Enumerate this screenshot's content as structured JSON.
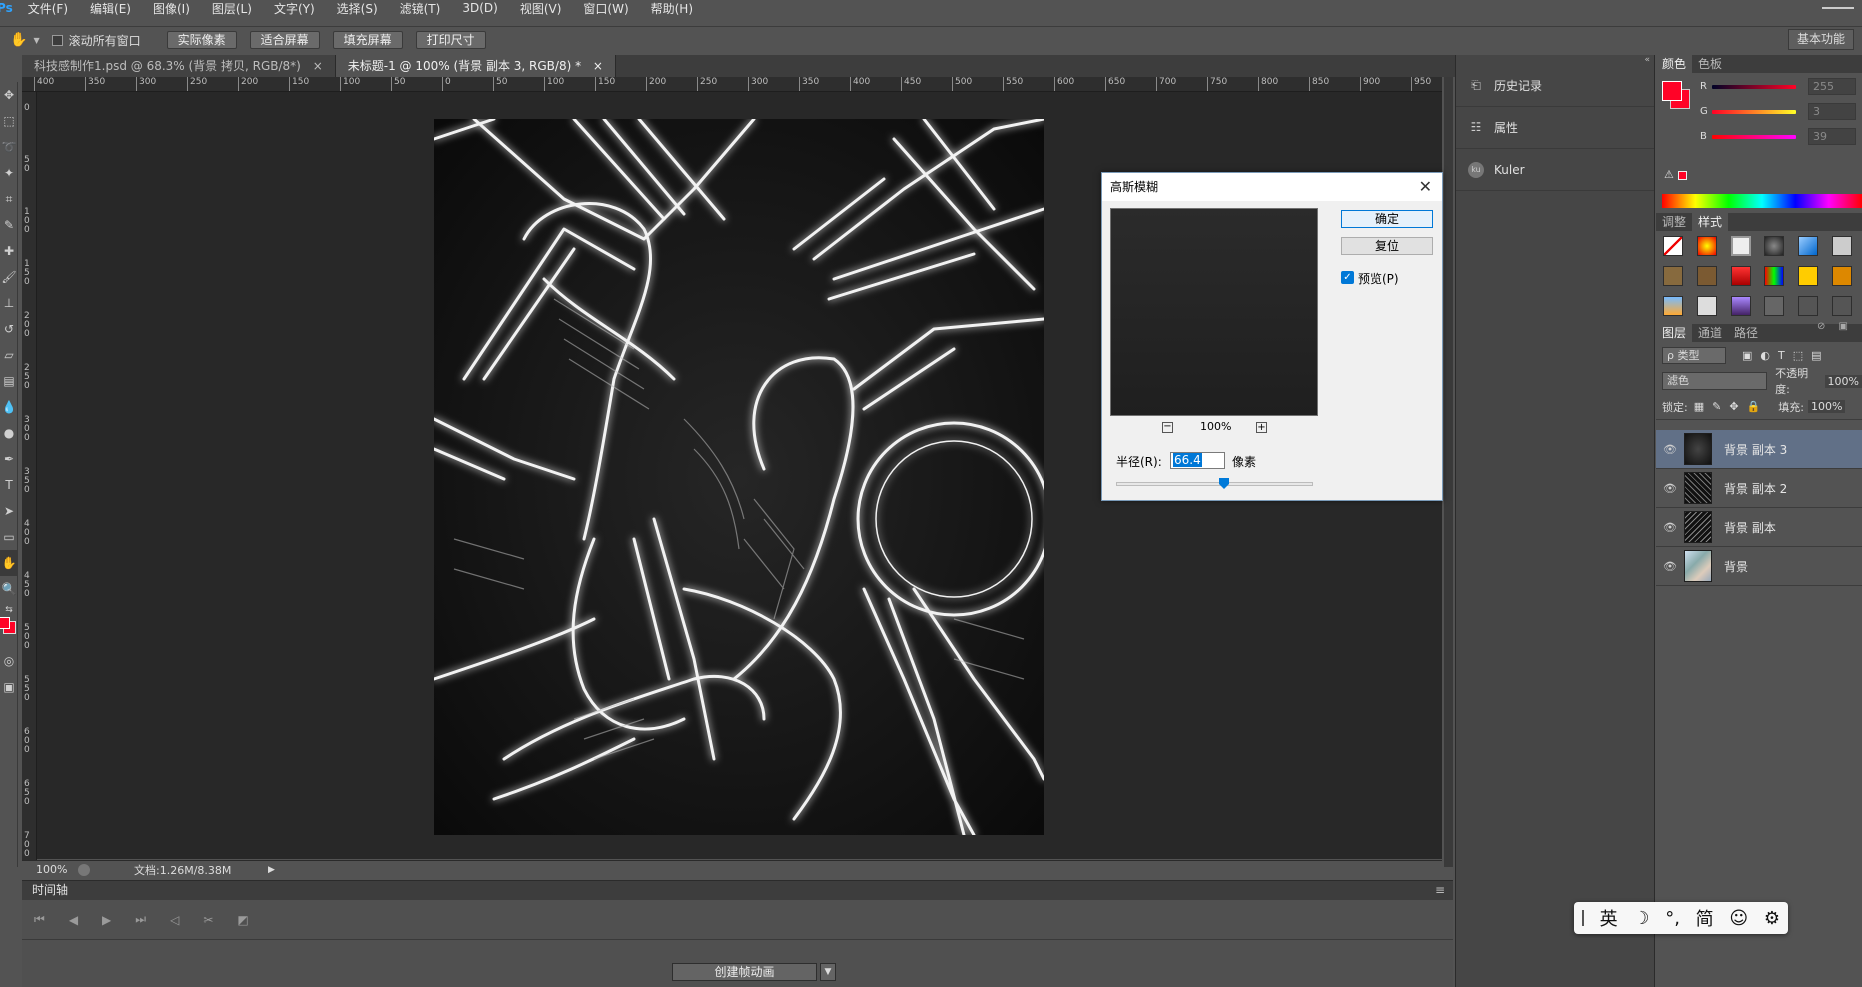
{
  "app": {
    "logo": "Ps"
  },
  "menu": [
    "文件(F)",
    "编辑(E)",
    "图像(I)",
    "图层(L)",
    "文字(Y)",
    "选择(S)",
    "滤镜(T)",
    "3D(D)",
    "视图(V)",
    "窗口(W)",
    "帮助(H)"
  ],
  "options": {
    "scroll_all": "滚动所有窗口",
    "buttons": [
      "实际像素",
      "适合屏幕",
      "填充屏幕",
      "打印尺寸"
    ],
    "workspace": "基本功能"
  },
  "tabs": [
    {
      "label": "科技感制作1.psd @ 68.3% (背景 拷贝, RGB/8*)",
      "close": "×"
    },
    {
      "label": "未标题-1 @ 100% (背景 副本 3, RGB/8) *",
      "close": "×"
    }
  ],
  "ruler_h": [
    "400",
    "350",
    "300",
    "250",
    "200",
    "150",
    "100",
    "50",
    "0",
    "50",
    "100",
    "150",
    "200",
    "250",
    "300",
    "350",
    "400",
    "450",
    "500",
    "550",
    "600",
    "650",
    "700",
    "750",
    "800",
    "850",
    "900",
    "950"
  ],
  "ruler_v": [
    "0",
    "5 0",
    "1 0 0",
    "1 5 0",
    "2 0 0",
    "2 5 0",
    "3 0 0",
    "3 5 0",
    "4 0 0",
    "4 5 0",
    "5 0 0",
    "5 5 0",
    "6 0 0",
    "6 5 0",
    "7 0 0"
  ],
  "status": {
    "zoom": "100%",
    "doc": "文档:1.26M/8.38M"
  },
  "timeline": {
    "title": "时间轴",
    "create_button": "创建帧动画"
  },
  "dock": [
    {
      "label": "历史记录",
      "icon": "history-icon"
    },
    {
      "label": "属性",
      "icon": "properties-icon"
    },
    {
      "label": "Kuler",
      "icon": "kuler-icon"
    }
  ],
  "color_panel": {
    "tabs": [
      "颜色",
      "色板"
    ],
    "channels": [
      {
        "label": "R",
        "value": "255"
      },
      {
        "label": "G",
        "value": "3"
      },
      {
        "label": "B",
        "value": "39"
      }
    ],
    "foreground": "#ff0327"
  },
  "styles_panel": {
    "tabs": [
      "调整",
      "样式"
    ]
  },
  "layers_panel": {
    "tabs": [
      "图层",
      "通道",
      "路径"
    ],
    "filter": "ρ 类型",
    "blend_mode": "滤色",
    "opacity_label": "不透明度:",
    "opacity_value": "100%",
    "lock_label": "锁定:",
    "fill_label": "填充:",
    "fill_value": "100%",
    "layers": [
      {
        "name": "背景 副本 3",
        "active": true
      },
      {
        "name": "背景 副本 2",
        "active": false
      },
      {
        "name": "背景 副本",
        "active": false
      },
      {
        "name": "背景",
        "active": false
      }
    ]
  },
  "dialog": {
    "title": "高斯模糊",
    "ok": "确定",
    "reset": "复位",
    "preview_label": "预览(P)",
    "zoom": "100%",
    "radius_label": "半径(R):",
    "radius_value": "66.4",
    "unit": "像素"
  },
  "ime": {
    "items": [
      "英",
      "☽",
      "°,",
      "简",
      "☺",
      "⚙"
    ]
  }
}
